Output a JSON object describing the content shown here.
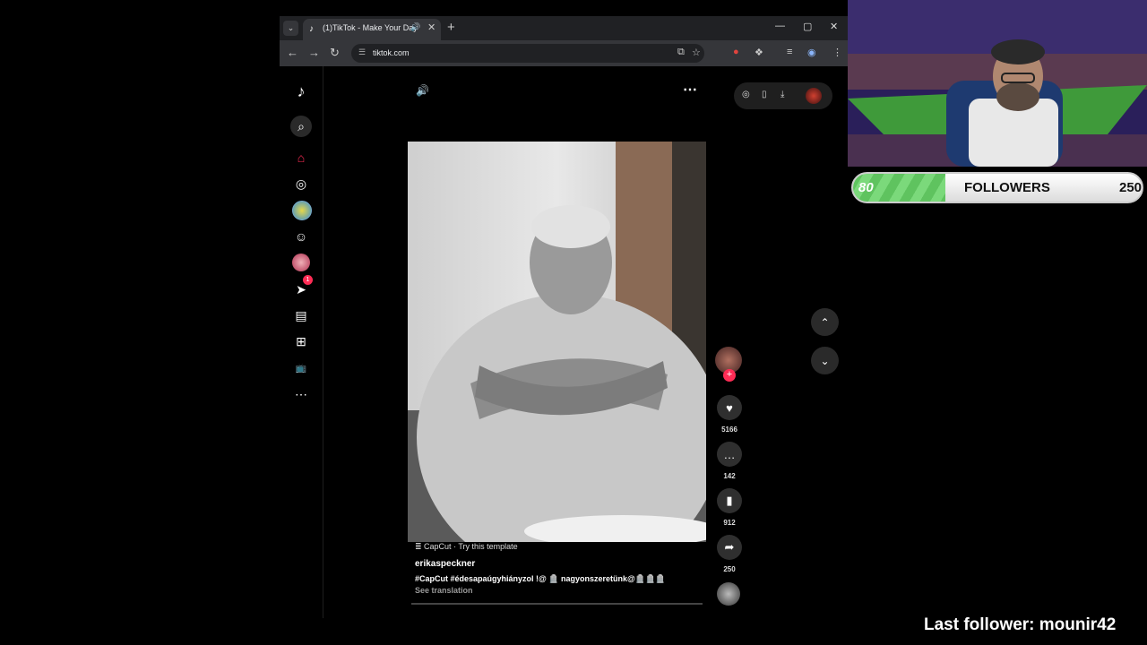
{
  "browser": {
    "tab_title": "(1)TikTok - Make Your Day",
    "url": "tiktok.com",
    "icons": [
      "tab-search-icon",
      "tiktok-favicon",
      "speaker-icon",
      "close-icon",
      "new-tab-icon",
      "minimize-icon",
      "maximize-icon",
      "window-close-icon",
      "back-icon",
      "forward-icon",
      "reload-icon",
      "site-info-icon",
      "install-icon",
      "star-icon",
      "extension-icon",
      "puzzle-icon",
      "media-icon",
      "profile-icon",
      "menu-icon"
    ]
  },
  "sidebar": {
    "notification_count": "1",
    "items": [
      "tiktok-logo",
      "search",
      "home",
      "explore",
      "following-avatar",
      "friends",
      "profile-avatar",
      "messages",
      "inbox",
      "upload",
      "live",
      "more"
    ]
  },
  "video": {
    "template_label": "CapCut · Try this template",
    "author": "erikaspeckner",
    "description": "#CapCut  #édesapaúgyhiányzol !@ 🪦  nagyonszeretünk@🪦🪦🪦",
    "see_translation": "See translation"
  },
  "actions": {
    "likes": "5166",
    "comments": "142",
    "saves": "912",
    "shares": "250"
  },
  "stream_overlay": {
    "followers_current": "80",
    "followers_label": "FOLLOWERS",
    "followers_goal": "250",
    "followers_progress": 0.32,
    "last_follower": "Last follower: mounir42"
  },
  "colors": {
    "accent": "#fe2c55",
    "progress": "#6fd06f"
  }
}
